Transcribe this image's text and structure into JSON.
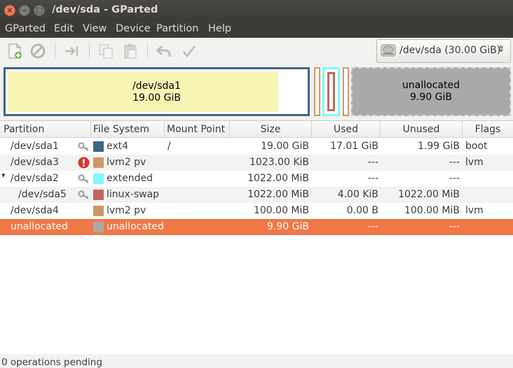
{
  "window": {
    "title": "/dev/sda - GParted"
  },
  "menu": [
    "GParted",
    "Edit",
    "View",
    "Device",
    "Partition",
    "Help"
  ],
  "toolbar": {
    "icons": [
      "new-partition-icon",
      "delete-icon",
      "resize-move-icon",
      "copy-icon",
      "paste-icon",
      "undo-icon",
      "apply-icon"
    ]
  },
  "device_selector": {
    "label": "/dev/sda  (30.00 GiB)"
  },
  "diskmap": {
    "sda1": {
      "name": "/dev/sda1",
      "size": "19.00 GiB",
      "used_fraction": 0.895
    },
    "unallocated": {
      "name": "unallocated",
      "size": "9.90 GiB"
    }
  },
  "columns": [
    "Partition",
    "File System",
    "Mount Point",
    "Size",
    "Used",
    "Unused",
    "Flags"
  ],
  "rows": [
    {
      "partition": "/dev/sda1",
      "icon": "key-icon",
      "fs": "ext4",
      "color": "#3f6586",
      "mount": "/",
      "size": "19.00 GiB",
      "used": "17.01 GiB",
      "unused": "1.99 GiB",
      "flags": "boot",
      "indent": 0
    },
    {
      "partition": "/dev/sda3",
      "icon": "warning-icon",
      "fs": "lvm2 pv",
      "color": "#cc9966",
      "mount": "",
      "size": "1023.00 KiB",
      "used": "---",
      "unused": "---",
      "flags": "lvm",
      "indent": 0
    },
    {
      "partition": "/dev/sda2",
      "icon": "key-icon",
      "fs": "extended",
      "color": "#7ef9fa",
      "mount": "",
      "size": "1022.00 MiB",
      "used": "---",
      "unused": "---",
      "flags": "",
      "indent": 0,
      "expander": "▾"
    },
    {
      "partition": "/dev/sda5",
      "icon": "key-icon",
      "fs": "linux-swap",
      "color": "#c1665a",
      "mount": "",
      "size": "1022.00 MiB",
      "used": "4.00 KiB",
      "unused": "1022.00 MiB",
      "flags": "",
      "indent": 1
    },
    {
      "partition": "/dev/sda4",
      "icon": "",
      "fs": "lvm2 pv",
      "color": "#cc9966",
      "mount": "",
      "size": "100.00 MiB",
      "used": "0.00 B",
      "unused": "100.00 MiB",
      "flags": "lvm",
      "indent": 0
    },
    {
      "partition": "unallocated",
      "icon": "",
      "fs": "unallocated",
      "color": "#a9a9a9",
      "mount": "",
      "size": "9.90 GiB",
      "used": "---",
      "unused": "---",
      "flags": "",
      "indent": 0,
      "selected": true
    }
  ],
  "status": {
    "text": "0 operations pending"
  },
  "colors": {
    "accent": "#f07746",
    "sda1_fill": "#f7f5b4"
  }
}
